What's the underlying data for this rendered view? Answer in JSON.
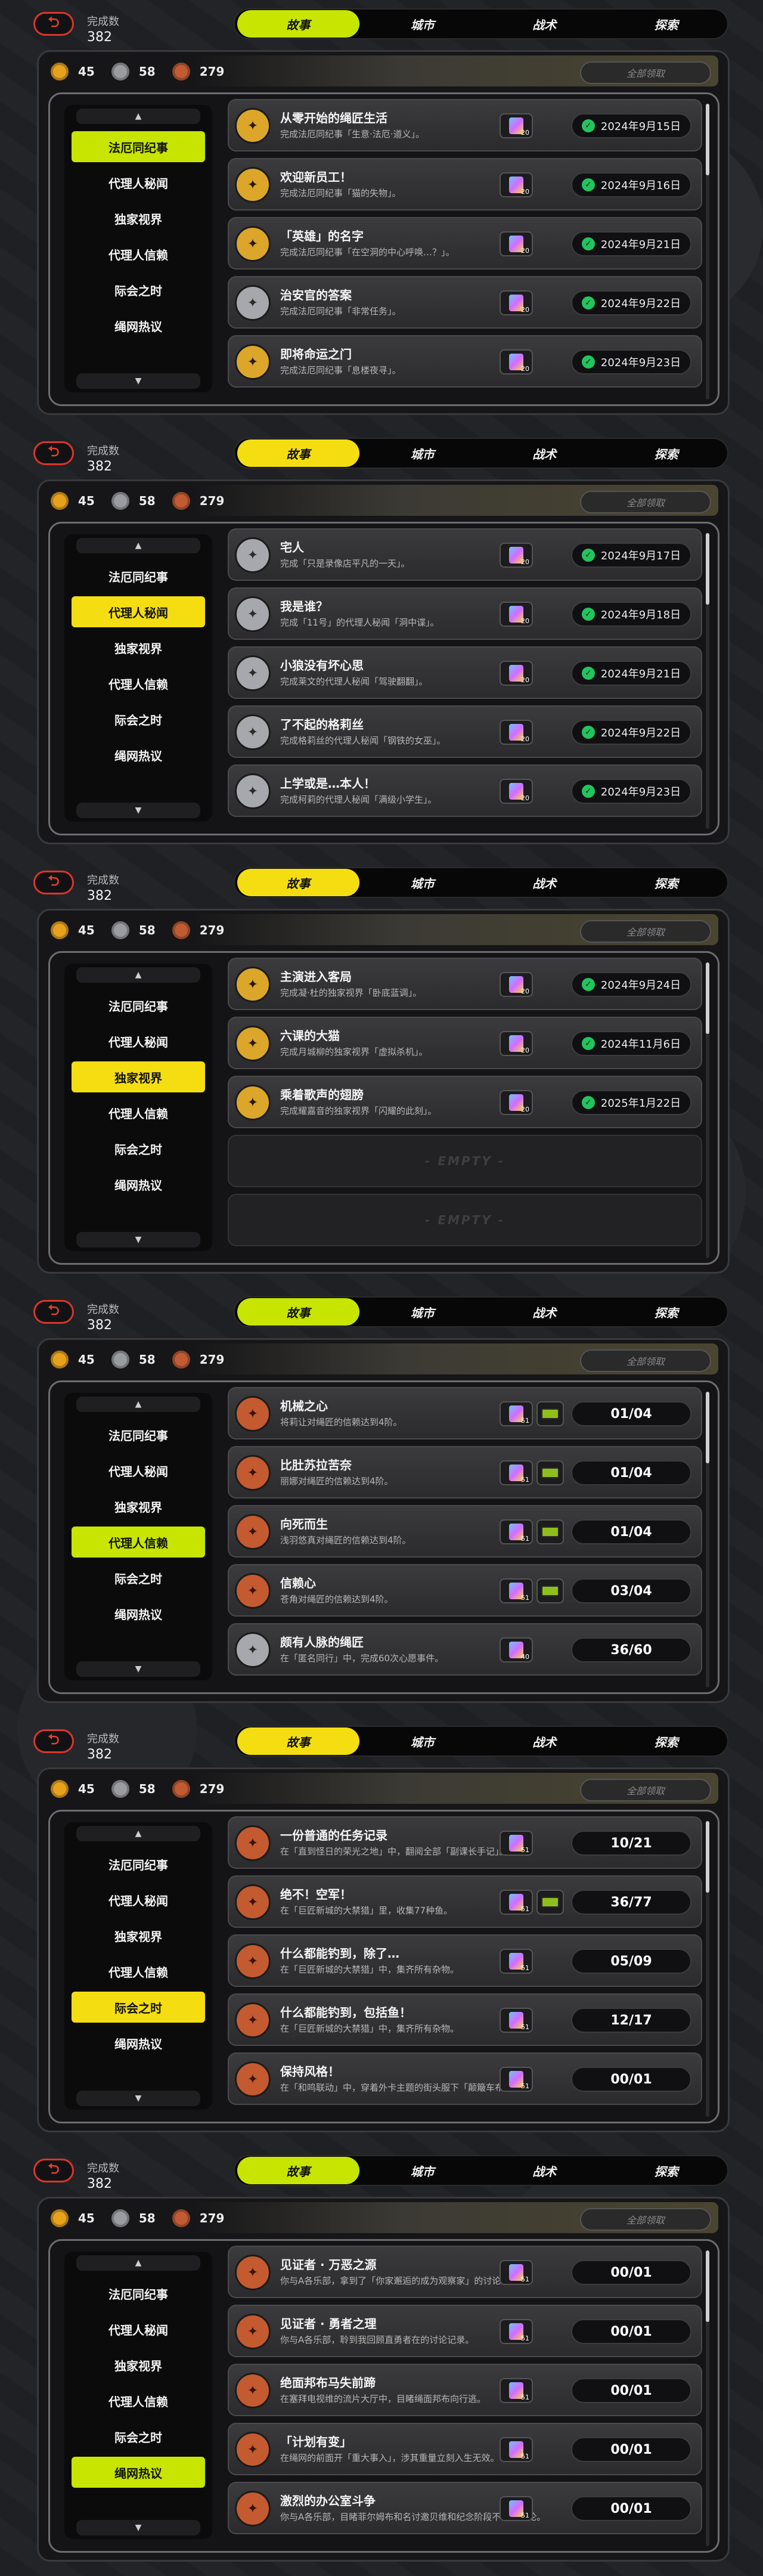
{
  "common": {
    "completion_label": "完成数",
    "completion_value": "382",
    "tabs": [
      "故事",
      "城市",
      "战术",
      "探索"
    ],
    "currencies": [
      "45",
      "58",
      "279"
    ],
    "claim_all": "全部领取",
    "empty_label": "- EMPTY -",
    "sidebar": [
      "法厄同纪事",
      "代理人秘闻",
      "独家视界",
      "代理人信赖",
      "际会之时",
      "绳网热议"
    ],
    "accent_green": "#c7e500",
    "accent_yellow": "#f4de12"
  },
  "screens": [
    {
      "active_sidebar": 0,
      "rows": [
        {
          "title": "从零开始的绳匠生活",
          "desc": "完成法厄同纪事「生意·法厄·道义」。",
          "icon": "gold",
          "reward": "20",
          "status": "2024年9月15日"
        },
        {
          "title": "欢迎新员工！",
          "desc": "完成法厄同纪事「猫的失物」。",
          "icon": "gold",
          "reward": "20",
          "status": "2024年9月16日"
        },
        {
          "title": "「英雄」的名字",
          "desc": "完成法厄同纪事「在空洞的中心呼唤…？」。",
          "icon": "gold",
          "reward": "20",
          "status": "2024年9月21日"
        },
        {
          "title": "治安官的答案",
          "desc": "完成法厄同纪事「非常任务」。",
          "icon": "silver",
          "reward": "20",
          "status": "2024年9月22日"
        },
        {
          "title": "即将命运之门",
          "desc": "完成法厄同纪事「息楼夜寻」。",
          "icon": "gold",
          "reward": "20",
          "status": "2024年9月23日"
        }
      ]
    },
    {
      "active_sidebar": 1,
      "rows": [
        {
          "title": "宅人",
          "desc": "完成「只是录像店平凡的一天」。",
          "icon": "silver",
          "reward": "20",
          "status": "2024年9月17日"
        },
        {
          "title": "我是谁？",
          "desc": "完成「11号」的代理人秘闻「洞中谍」。",
          "icon": "silver",
          "reward": "20",
          "status": "2024年9月18日"
        },
        {
          "title": "小狼没有坏心思",
          "desc": "完成莱文的代理人秘闻「驾驶翻翻」。",
          "icon": "silver",
          "reward": "20",
          "status": "2024年9月21日"
        },
        {
          "title": "了不起的格莉丝",
          "desc": "完成格莉丝的代理人秘闻「钢铁的女巫」。",
          "icon": "silver",
          "reward": "20",
          "status": "2024年9月22日"
        },
        {
          "title": "上学或是…本人！",
          "desc": "完成柯莉的代理人秘闻「满级小学生」。",
          "icon": "silver",
          "reward": "20",
          "status": "2024年9月23日"
        }
      ]
    },
    {
      "active_sidebar": 2,
      "rows": [
        {
          "title": "主演进入客局",
          "desc": "完成凝·杜的独家视界「卧底蓝调」。",
          "icon": "gold",
          "reward": "20",
          "status": "2024年9月24日"
        },
        {
          "title": "六课的大猫",
          "desc": "完成月城柳的独家视界「虚拟杀机」。",
          "icon": "gold",
          "reward": "20",
          "status": "2024年11月6日"
        },
        {
          "title": "乘着歌声的翅膀",
          "desc": "完成耀嘉音的独家视界「闪耀的此刻」。",
          "icon": "gold",
          "reward": "20",
          "status": "2025年1月22日"
        }
      ],
      "empty_rows": 2
    },
    {
      "active_sidebar": 3,
      "rows": [
        {
          "title": "机械之心",
          "desc": "将莉让对绳匠的信赖达到4阶。",
          "icon": "bronze",
          "reward": "51",
          "chip": true,
          "progress": "01/04"
        },
        {
          "title": "比肚苏拉苦奈",
          "desc": "丽娜对绳匠的信赖达到4阶。",
          "icon": "bronze",
          "reward": "51",
          "chip": true,
          "progress": "01/04"
        },
        {
          "title": "向死而生",
          "desc": "浅羽悠真对绳匠的信赖达到4阶。",
          "icon": "bronze",
          "reward": "51",
          "chip": true,
          "progress": "01/04"
        },
        {
          "title": "信赖心",
          "desc": "苍角对绳匠的信赖达到4阶。",
          "icon": "bronze",
          "reward": "51",
          "chip": true,
          "progress": "03/04"
        },
        {
          "title": "颇有人脉的绳匠",
          "desc": "在「匿名同行」中，完成60次心愿事件。",
          "icon": "silver",
          "reward": "40",
          "chip": false,
          "progress": "36/60"
        }
      ]
    },
    {
      "active_sidebar": 4,
      "rows": [
        {
          "title": "一份普通的任务记录",
          "desc": "在「直到怪日的荣光之地」中，翻阅全部「副课长手记」。",
          "icon": "bronze",
          "reward": "51",
          "chip": false,
          "progress": "10/21"
        },
        {
          "title": "绝不！空军！",
          "desc": "在「巨匠新城的大禁猎」里，收集77种鱼。",
          "icon": "bronze",
          "reward": "51",
          "chip": true,
          "progress": "36/77"
        },
        {
          "title": "什么都能钓到，除了…",
          "desc": "在「巨匠新城的大禁猎」中，集齐所有杂物。",
          "icon": "bronze",
          "reward": "51",
          "chip": false,
          "progress": "05/09"
        },
        {
          "title": "什么都能钓到，包括鱼！",
          "desc": "在「巨匠新城的大禁猎」中，集齐所有杂物。",
          "icon": "bronze",
          "reward": "51",
          "chip": false,
          "progress": "12/17"
        },
        {
          "title": "保持风格！",
          "desc": "在「和鸣联动」中，穿着外卡主题的街头服下「颠簸车布」。",
          "icon": "bronze",
          "reward": "51",
          "chip": false,
          "progress": "00/01"
        }
      ]
    },
    {
      "active_sidebar": 5,
      "rows": [
        {
          "title": "见证者 · 万恶之源",
          "desc": "你与A各乐部，拿到了「你家邂逅的成为观察家」的讨论。",
          "icon": "bronze",
          "reward": "51",
          "chip": false,
          "progress": "00/01"
        },
        {
          "title": "见证者 · 勇者之理",
          "desc": "你与A各乐部，聆到我回顾直勇者在的讨论记录。",
          "icon": "bronze",
          "reward": "51",
          "chip": false,
          "progress": "00/01"
        },
        {
          "title": "绝面邦布马失前蹄",
          "desc": "在塞拜电视维的流片大厅中，目睹绳面邦布向行逃。",
          "icon": "bronze",
          "reward": "51",
          "chip": false,
          "progress": "00/01"
        },
        {
          "title": "「计划有变」",
          "desc": "在绳网的前面开「重大事入」，涉其重量立刻入生无效。",
          "icon": "bronze",
          "reward": "51",
          "chip": false,
          "progress": "00/01"
        },
        {
          "title": "激烈的办公室斗争",
          "desc": "你与A各乐部，目睹菲尔姆布和名讨邀贝维和纪念阶段不利的讨论。",
          "icon": "bronze",
          "reward": "51",
          "chip": false,
          "progress": "00/01"
        }
      ]
    }
  ]
}
